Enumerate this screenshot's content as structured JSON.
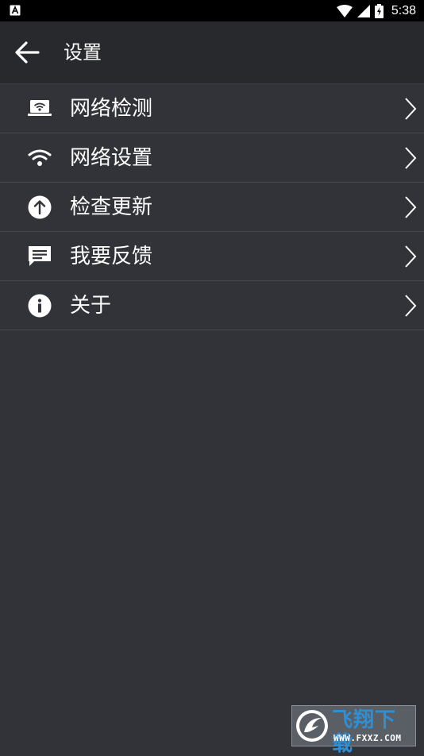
{
  "status_bar": {
    "time": "5:38",
    "icons": [
      "notification-a-icon",
      "wifi-icon",
      "cell-signal-icon",
      "battery-charging-icon"
    ]
  },
  "header": {
    "title": "设置",
    "back_icon": "arrow-back-icon"
  },
  "menu": {
    "items": [
      {
        "label": "网络检测",
        "icon": "laptop-wifi-icon"
      },
      {
        "label": "网络设置",
        "icon": "wifi-icon"
      },
      {
        "label": "检查更新",
        "icon": "arrow-up-circle-icon"
      },
      {
        "label": "我要反馈",
        "icon": "chat-message-icon"
      },
      {
        "label": "关于",
        "icon": "info-circle-icon"
      }
    ],
    "chevron_icon": "chevron-right-icon"
  },
  "watermark": {
    "cn": "飞翔下载",
    "en": "WWW.FXXZ.COM"
  },
  "colors": {
    "background": "#323338",
    "app_bar": "#28292d",
    "status_bar": "#000000",
    "divider": "#46474c",
    "text": "#ffffff"
  }
}
